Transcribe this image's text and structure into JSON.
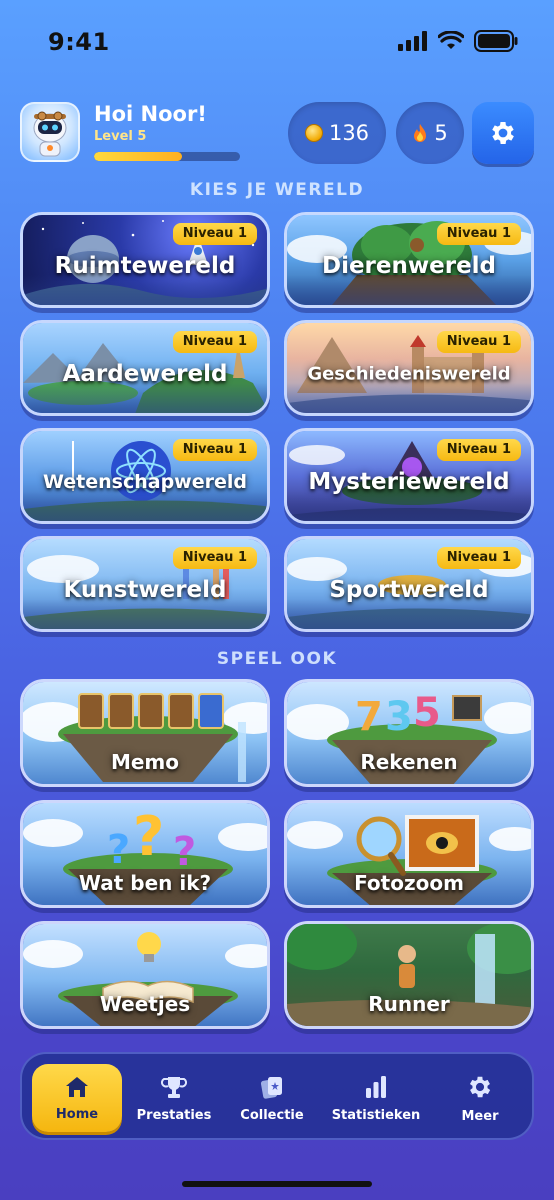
{
  "status_bar": {
    "time": "9:41"
  },
  "header": {
    "greeting": "Hoi Noor!",
    "level": "Level 5",
    "xp_progress": 0.6,
    "coins": "136",
    "streak": "5"
  },
  "worlds_section": {
    "title": "KIES JE WERELD",
    "worlds": [
      {
        "name": "Ruimtewereld",
        "badge": "Niveau 1"
      },
      {
        "name": "Dierenwereld",
        "badge": "Niveau 1"
      },
      {
        "name": "Aardewereld",
        "badge": "Niveau 1"
      },
      {
        "name": "Geschiedeniswereld",
        "badge": "Niveau 1"
      },
      {
        "name": "Wetenschapwereld",
        "badge": "Niveau 1"
      },
      {
        "name": "Mysteriewereld",
        "badge": "Niveau 1"
      },
      {
        "name": "Kunstwereld",
        "badge": "Niveau 1"
      },
      {
        "name": "Sportwereld",
        "badge": "Niveau 1"
      }
    ]
  },
  "games_section": {
    "title": "SPEEL OOK",
    "games": [
      {
        "name": "Memo"
      },
      {
        "name": "Rekenen"
      },
      {
        "name": "Wat ben ik?"
      },
      {
        "name": "Fotozoom"
      },
      {
        "name": "Weetjes"
      },
      {
        "name": "Runner"
      }
    ]
  },
  "bottom_nav": {
    "items": [
      {
        "label": "Home",
        "icon": "home-icon",
        "active": true
      },
      {
        "label": "Prestaties",
        "icon": "trophy-icon"
      },
      {
        "label": "Collectie",
        "icon": "cards-icon"
      },
      {
        "label": "Statistieken",
        "icon": "bar-chart-icon"
      },
      {
        "label": "Meer",
        "icon": "gear-icon"
      }
    ]
  },
  "colors": {
    "accent_yellow": "#f6b912",
    "settings_blue": "#2464e8",
    "nav_bg": "#1e2d8c"
  }
}
